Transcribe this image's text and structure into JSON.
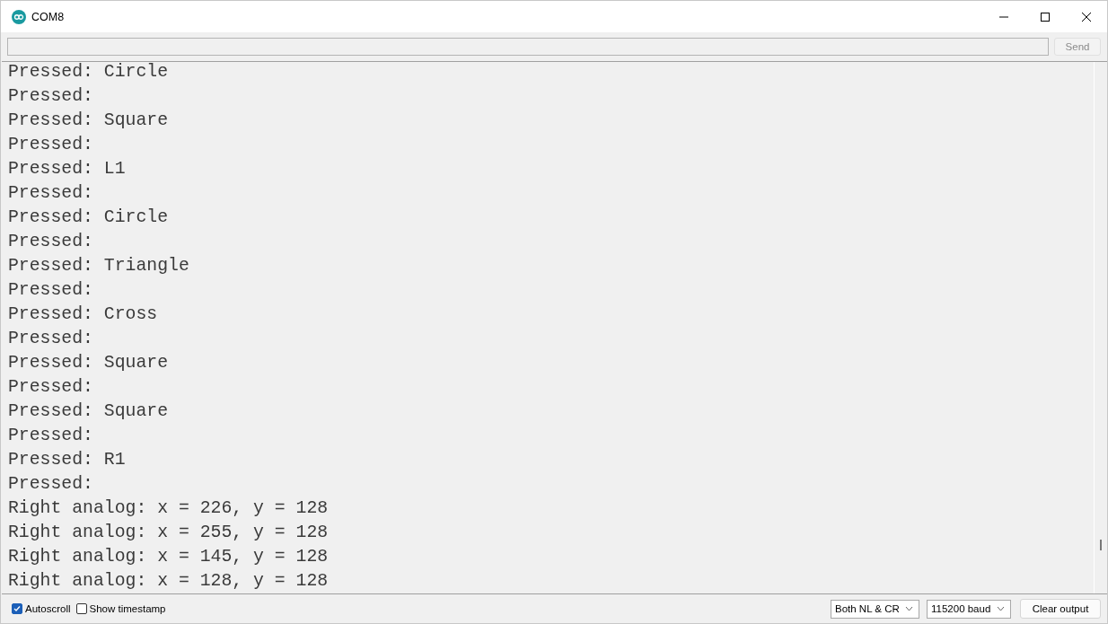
{
  "window": {
    "title": "COM8"
  },
  "send": {
    "label": "Send",
    "disabled": true
  },
  "output": [
    "Pressed: Circle",
    "Pressed:",
    "Pressed: Square",
    "Pressed:",
    "Pressed: L1",
    "Pressed:",
    "Pressed: Circle",
    "Pressed:",
    "Pressed: Triangle",
    "Pressed:",
    "Pressed: Cross",
    "Pressed:",
    "Pressed: Square",
    "Pressed:",
    "Pressed: Square",
    "Pressed:",
    "Pressed: R1",
    "Pressed:",
    "Right analog: x = 226, y = 128",
    "Right analog: x = 255, y = 128",
    "Right analog: x = 145, y = 128",
    "Right analog: x = 128, y = 128"
  ],
  "options": [
    {
      "label": "Autoscroll",
      "checked": true
    },
    {
      "label": "Show timestamp",
      "checked": false
    }
  ],
  "line_ending": "Both NL & CR",
  "baud": "115200 baud",
  "clear": "Clear output"
}
